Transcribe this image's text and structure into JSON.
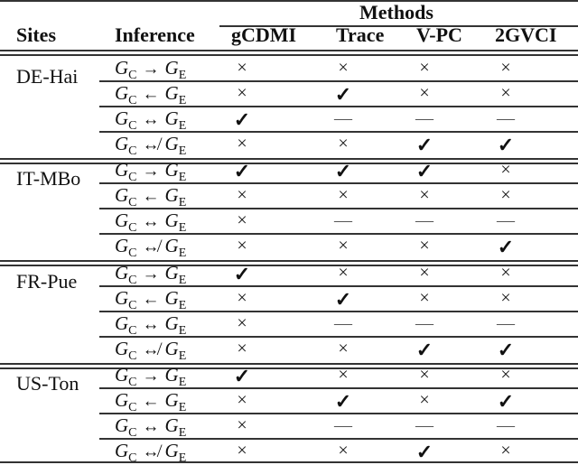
{
  "table": {
    "header": {
      "sites": "Sites",
      "inference": "Inference",
      "methods_group": "Methods",
      "methods": [
        "gCDMI",
        "Trace",
        "V-PC",
        "2GVCI"
      ]
    },
    "inference_labels": [
      {
        "left": "G",
        "left_sub": "C",
        "arrow": "→",
        "right": "G",
        "right_sub": "E"
      },
      {
        "left": "G",
        "left_sub": "C",
        "arrow": "←",
        "right": "G",
        "right_sub": "E"
      },
      {
        "left": "G",
        "left_sub": "C",
        "arrow": "↔",
        "right": "G",
        "right_sub": "E"
      },
      {
        "left": "G",
        "left_sub": "C",
        "arrow": "↮",
        "right": "G",
        "right_sub": "E"
      }
    ],
    "symbols": {
      "yes": "✓",
      "no": "×",
      "na": "—"
    },
    "groups": [
      {
        "site": "DE-Hai",
        "rows": [
          [
            "no",
            "no",
            "no",
            "no"
          ],
          [
            "no",
            "yes",
            "no",
            "no"
          ],
          [
            "yes",
            "na",
            "na",
            "na"
          ],
          [
            "no",
            "no",
            "yes",
            "yes"
          ]
        ]
      },
      {
        "site": "IT-MBo",
        "rows": [
          [
            "yes",
            "yes",
            "yes",
            "no"
          ],
          [
            "no",
            "no",
            "no",
            "no"
          ],
          [
            "no",
            "na",
            "na",
            "na"
          ],
          [
            "no",
            "no",
            "no",
            "yes"
          ]
        ]
      },
      {
        "site": "FR-Pue",
        "rows": [
          [
            "yes",
            "no",
            "no",
            "no"
          ],
          [
            "no",
            "yes",
            "no",
            "no"
          ],
          [
            "no",
            "na",
            "na",
            "na"
          ],
          [
            "no",
            "no",
            "yes",
            "yes"
          ]
        ]
      },
      {
        "site": "US-Ton",
        "rows": [
          [
            "yes",
            "no",
            "no",
            "no"
          ],
          [
            "no",
            "yes",
            "no",
            "yes"
          ],
          [
            "no",
            "na",
            "na",
            "na"
          ],
          [
            "no",
            "no",
            "yes",
            "no"
          ]
        ]
      }
    ]
  }
}
